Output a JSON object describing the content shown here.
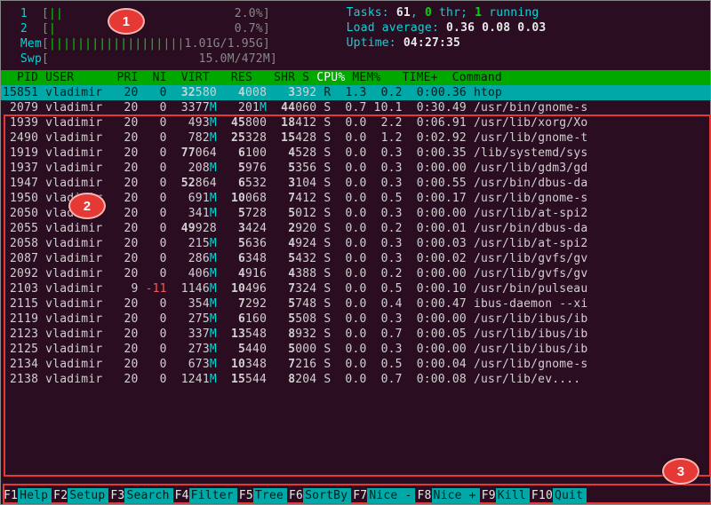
{
  "badges": {
    "b1": "1",
    "b2": "2",
    "b3": "3"
  },
  "meters": {
    "cpu1_label": "1  ",
    "cpu1_bar": "[||                        ",
    "cpu1_val": "2.0%]",
    "cpu2_label": "2  ",
    "cpu2_bar": "[|                         ",
    "cpu2_val": "0.7%]",
    "mem_label": "Mem",
    "mem_bar": "[|||||||||||||||||||",
    "mem_val": "1.01G/1.95G]",
    "swp_label": "Swp",
    "swp_bar": "[                     ",
    "swp_val": "15.0M/472M]"
  },
  "stats": {
    "tasks_l": "Tasks: ",
    "tasks_n": "61",
    "tasks_sep1": ", ",
    "thr_n": "0",
    "thr_l": " thr; ",
    "run_n": "1",
    "run_l": " running",
    "load_l": "Load average: ",
    "load_1": "0.36",
    "load_2": " 0.08",
    "load_3": " 0.03",
    "uptime_l": "Uptime: ",
    "uptime_v": "04:27:35"
  },
  "thead": {
    "pid": "  PID",
    "user": " USER     ",
    "pri": " PRI",
    "ni": "  NI",
    "virt": "  VIRT",
    "res": "   RES",
    "shr": "   SHR",
    "s": " S",
    "cpu": " CPU%",
    "mem": " MEM%",
    "time": "   TIME+ ",
    "cmd": " Command"
  },
  "rows": [
    {
      "pid": "15851",
      "user": "vladimir",
      "pri": "20",
      "ni": "0",
      "virt": "32580",
      "res": "4008",
      "shr": "3392",
      "s": "R",
      "cpu": "1.3",
      "mem": "0.2",
      "time": "0:00.36",
      "cmd": "htop",
      "sel": true
    },
    {
      "pid": "2079",
      "user": "vladimir",
      "pri": "20",
      "ni": "0",
      "virt": "3377M",
      "res": "201M",
      "shr": "44060",
      "s": "S",
      "cpu": "0.7",
      "mem": "10.1",
      "time": "0:30.49",
      "cmd": "/usr/bin/gnome-s"
    },
    {
      "pid": "1939",
      "user": "vladimir",
      "pri": "20",
      "ni": "0",
      "virt": "493M",
      "res": "45800",
      "shr": "18412",
      "s": "S",
      "cpu": "0.0",
      "mem": "2.2",
      "time": "0:06.91",
      "cmd": "/usr/lib/xorg/Xo"
    },
    {
      "pid": "2490",
      "user": "vladimir",
      "pri": "20",
      "ni": "0",
      "virt": "782M",
      "res": "25328",
      "shr": "15428",
      "s": "S",
      "cpu": "0.0",
      "mem": "1.2",
      "time": "0:02.92",
      "cmd": "/usr/lib/gnome-t"
    },
    {
      "pid": "1919",
      "user": "vladimir",
      "pri": "20",
      "ni": "0",
      "virt": "77064",
      "res": "6100",
      "shr": "4528",
      "s": "S",
      "cpu": "0.0",
      "mem": "0.3",
      "time": "0:00.35",
      "cmd": "/lib/systemd/sys"
    },
    {
      "pid": "1937",
      "user": "vladimir",
      "pri": "20",
      "ni": "0",
      "virt": "208M",
      "res": "5976",
      "shr": "5356",
      "s": "S",
      "cpu": "0.0",
      "mem": "0.3",
      "time": "0:00.00",
      "cmd": "/usr/lib/gdm3/gd"
    },
    {
      "pid": "1947",
      "user": "vladimir",
      "pri": "20",
      "ni": "0",
      "virt": "52864",
      "res": "6532",
      "shr": "3104",
      "s": "S",
      "cpu": "0.0",
      "mem": "0.3",
      "time": "0:00.55",
      "cmd": "/usr/bin/dbus-da"
    },
    {
      "pid": "1950",
      "user": "vladimir",
      "pri": "20",
      "ni": "0",
      "virt": "691M",
      "res": "10068",
      "shr": "7412",
      "s": "S",
      "cpu": "0.0",
      "mem": "0.5",
      "time": "0:00.17",
      "cmd": "/usr/lib/gnome-s"
    },
    {
      "pid": "2050",
      "user": "vladimir",
      "pri": "20",
      "ni": "0",
      "virt": "341M",
      "res": "5728",
      "shr": "5012",
      "s": "S",
      "cpu": "0.0",
      "mem": "0.3",
      "time": "0:00.00",
      "cmd": "/usr/lib/at-spi2"
    },
    {
      "pid": "2055",
      "user": "vladimir",
      "pri": "20",
      "ni": "0",
      "virt": "49928",
      "res": "3424",
      "shr": "2920",
      "s": "S",
      "cpu": "0.0",
      "mem": "0.2",
      "time": "0:00.01",
      "cmd": "/usr/bin/dbus-da"
    },
    {
      "pid": "2058",
      "user": "vladimir",
      "pri": "20",
      "ni": "0",
      "virt": "215M",
      "res": "5636",
      "shr": "4924",
      "s": "S",
      "cpu": "0.0",
      "mem": "0.3",
      "time": "0:00.03",
      "cmd": "/usr/lib/at-spi2"
    },
    {
      "pid": "2087",
      "user": "vladimir",
      "pri": "20",
      "ni": "0",
      "virt": "286M",
      "res": "6348",
      "shr": "5432",
      "s": "S",
      "cpu": "0.0",
      "mem": "0.3",
      "time": "0:00.02",
      "cmd": "/usr/lib/gvfs/gv"
    },
    {
      "pid": "2092",
      "user": "vladimir",
      "pri": "20",
      "ni": "0",
      "virt": "406M",
      "res": "4916",
      "shr": "4388",
      "s": "S",
      "cpu": "0.0",
      "mem": "0.2",
      "time": "0:00.00",
      "cmd": "/usr/lib/gvfs/gv"
    },
    {
      "pid": "2103",
      "user": "vladimir",
      "pri": "9",
      "ni": "-11",
      "virt": "1146M",
      "res": "10496",
      "shr": "7324",
      "s": "S",
      "cpu": "0.0",
      "mem": "0.5",
      "time": "0:00.10",
      "cmd": "/usr/bin/pulseau"
    },
    {
      "pid": "2115",
      "user": "vladimir",
      "pri": "20",
      "ni": "0",
      "virt": "354M",
      "res": "7292",
      "shr": "5748",
      "s": "S",
      "cpu": "0.0",
      "mem": "0.4",
      "time": "0:00.47",
      "cmd": "ibus-daemon --xi"
    },
    {
      "pid": "2119",
      "user": "vladimir",
      "pri": "20",
      "ni": "0",
      "virt": "275M",
      "res": "6160",
      "shr": "5508",
      "s": "S",
      "cpu": "0.0",
      "mem": "0.3",
      "time": "0:00.00",
      "cmd": "/usr/lib/ibus/ib"
    },
    {
      "pid": "2123",
      "user": "vladimir",
      "pri": "20",
      "ni": "0",
      "virt": "337M",
      "res": "13548",
      "shr": "8932",
      "s": "S",
      "cpu": "0.0",
      "mem": "0.7",
      "time": "0:00.05",
      "cmd": "/usr/lib/ibus/ib"
    },
    {
      "pid": "2125",
      "user": "vladimir",
      "pri": "20",
      "ni": "0",
      "virt": "273M",
      "res": "5440",
      "shr": "5000",
      "s": "S",
      "cpu": "0.0",
      "mem": "0.3",
      "time": "0:00.00",
      "cmd": "/usr/lib/ibus/ib"
    },
    {
      "pid": "2134",
      "user": "vladimir",
      "pri": "20",
      "ni": "0",
      "virt": "673M",
      "res": "10348",
      "shr": "7216",
      "s": "S",
      "cpu": "0.0",
      "mem": "0.5",
      "time": "0:00.04",
      "cmd": "/usr/lib/gnome-s"
    },
    {
      "pid": "2138",
      "user": "vladimir",
      "pri": "20",
      "ni": "0",
      "virt": "1241M",
      "res": "15544",
      "shr": "8204",
      "s": "S",
      "cpu": "0.0",
      "mem": "0.7",
      "time": "0:00.08",
      "cmd": "/usr/lib/ev...."
    }
  ],
  "fn": [
    {
      "k": "F1",
      "l": "Help  "
    },
    {
      "k": "F2",
      "l": "Setup "
    },
    {
      "k": "F3",
      "l": "Search"
    },
    {
      "k": "F4",
      "l": "Filter"
    },
    {
      "k": "F5",
      "l": "Tree  "
    },
    {
      "k": "F6",
      "l": "SortBy"
    },
    {
      "k": "F7",
      "l": "Nice -"
    },
    {
      "k": "F8",
      "l": "Nice +"
    },
    {
      "k": "F9",
      "l": "Kill  "
    },
    {
      "k": "F10",
      "l": "Quit "
    }
  ]
}
